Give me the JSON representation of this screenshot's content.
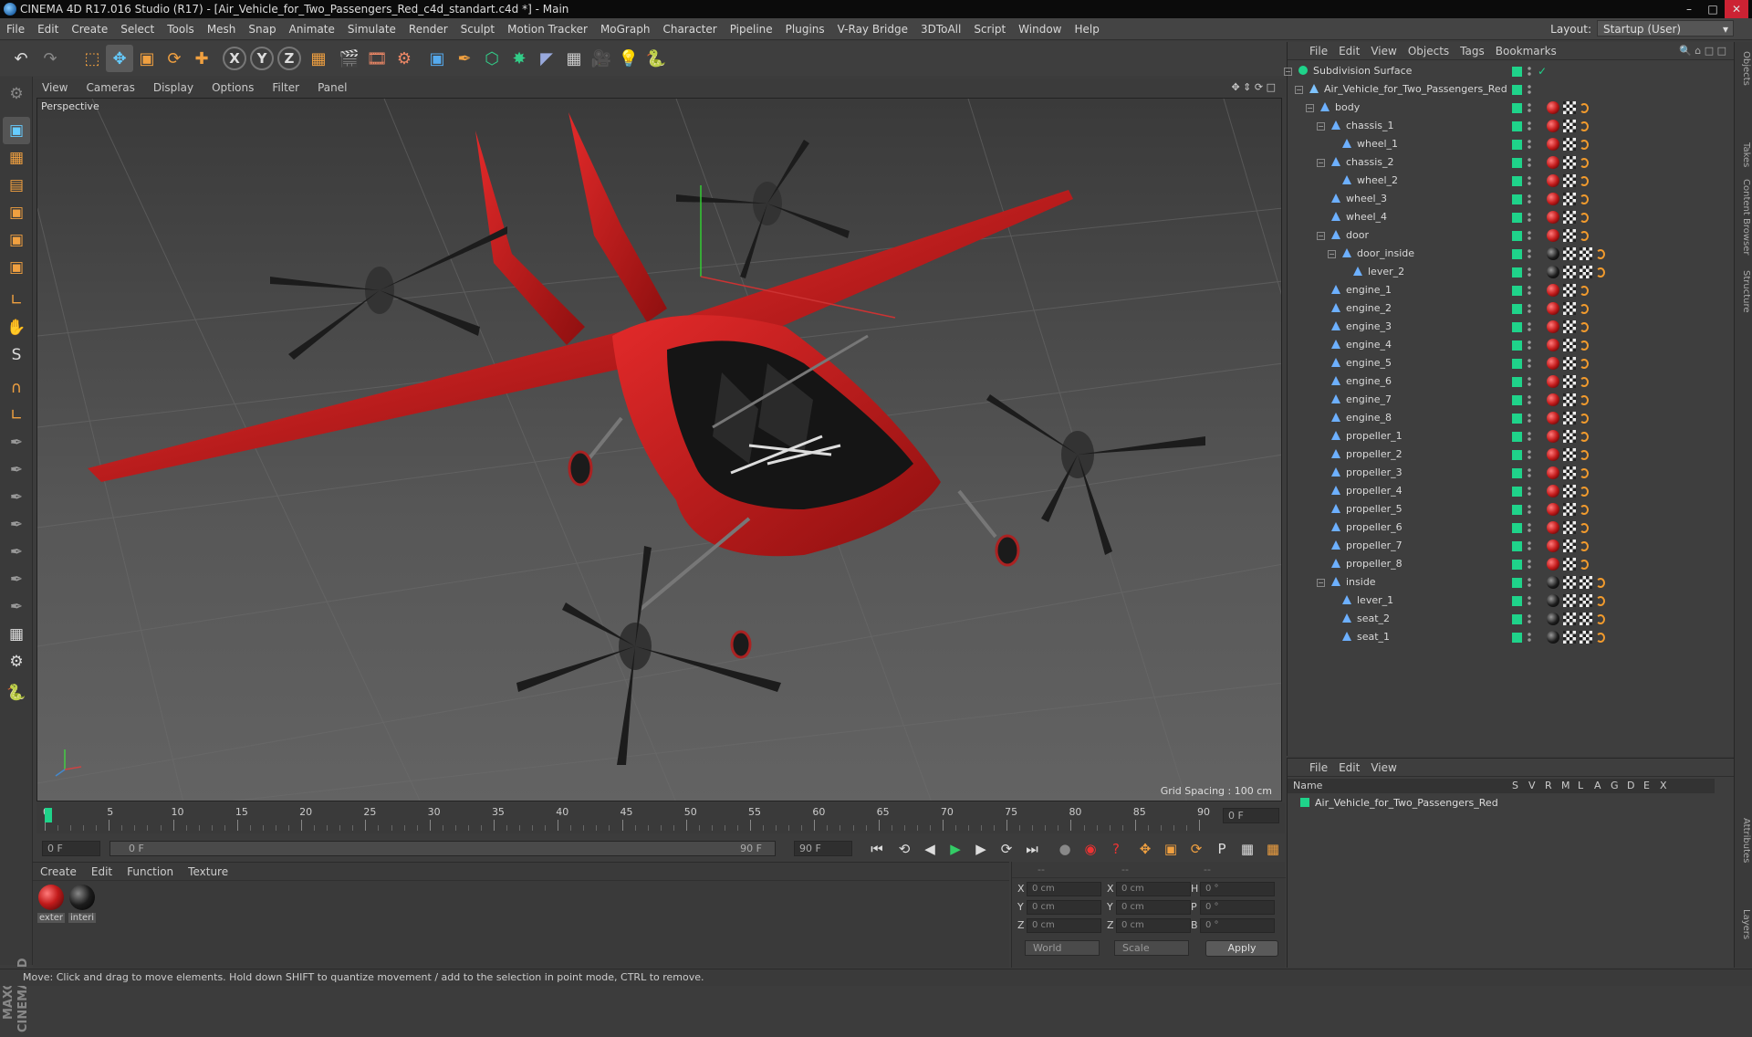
{
  "window": {
    "title": "CINEMA 4D R17.016 Studio (R17) - [Air_Vehicle_for_Two_Passengers_Red_c4d_standart.c4d *] - Main"
  },
  "menubar": [
    "File",
    "Edit",
    "Create",
    "Select",
    "Tools",
    "Mesh",
    "Snap",
    "Animate",
    "Simulate",
    "Render",
    "Sculpt",
    "Motion Tracker",
    "MoGraph",
    "Character",
    "Pipeline",
    "Plugins",
    "V-Ray Bridge",
    "3DToAll",
    "Script",
    "Window",
    "Help"
  ],
  "layout": {
    "label": "Layout:",
    "value": "Startup (User)"
  },
  "viewport": {
    "menu": [
      "View",
      "Cameras",
      "Display",
      "Options",
      "Filter",
      "Panel"
    ],
    "camera_label": "Perspective",
    "grid_spacing": "Grid Spacing : 100 cm"
  },
  "timeline": {
    "ticks": [
      "0",
      "5",
      "10",
      "15",
      "20",
      "25",
      "30",
      "35",
      "40",
      "45",
      "50",
      "55",
      "60",
      "65",
      "70",
      "75",
      "80",
      "85",
      "90"
    ],
    "end_frame_field": "0 F",
    "current_frame": "0 F",
    "range_start": "0 F",
    "range_end": "90 F",
    "max_frame": "90 F"
  },
  "materials": {
    "menu": [
      "Create",
      "Edit",
      "Function",
      "Texture"
    ],
    "items": [
      {
        "name": "exter",
        "color": "#c21b1b"
      },
      {
        "name": "interi",
        "color": "#1c1c1c"
      }
    ]
  },
  "coordinates": {
    "header": [
      "--",
      "--",
      "--"
    ],
    "rows": [
      {
        "a": "X",
        "av": "0 cm",
        "b": "X",
        "bv": "0 cm",
        "c": "H",
        "cv": "0 °"
      },
      {
        "a": "Y",
        "av": "0 cm",
        "b": "Y",
        "bv": "0 cm",
        "c": "P",
        "cv": "0 °"
      },
      {
        "a": "Z",
        "av": "0 cm",
        "b": "Z",
        "bv": "0 cm",
        "c": "B",
        "cv": "0 °"
      }
    ],
    "space": "World",
    "mode": "Scale",
    "apply": "Apply"
  },
  "status": "Move: Click and drag to move elements. Hold down SHIFT to quantize movement / add to the selection in point mode, CTRL to remove.",
  "object_manager": {
    "menu": [
      "File",
      "Edit",
      "View",
      "Objects",
      "Tags",
      "Bookmarks"
    ],
    "objects": [
      {
        "name": "Subdivision Surface",
        "depth": 0,
        "tag": "none"
      },
      {
        "name": "Air_Vehicle_for_Two_Passengers_Red",
        "depth": 1,
        "tag": "none"
      },
      {
        "name": "body",
        "depth": 2,
        "tag": "red"
      },
      {
        "name": "chassis_1",
        "depth": 3,
        "tag": "red"
      },
      {
        "name": "wheel_1",
        "depth": 4,
        "tag": "red"
      },
      {
        "name": "chassis_2",
        "depth": 3,
        "tag": "red"
      },
      {
        "name": "wheel_2",
        "depth": 4,
        "tag": "red"
      },
      {
        "name": "wheel_3",
        "depth": 3,
        "tag": "red"
      },
      {
        "name": "wheel_4",
        "depth": 3,
        "tag": "red"
      },
      {
        "name": "door",
        "depth": 3,
        "tag": "red"
      },
      {
        "name": "door_inside",
        "depth": 4,
        "tag": "black"
      },
      {
        "name": "lever_2",
        "depth": 5,
        "tag": "black"
      },
      {
        "name": "engine_1",
        "depth": 3,
        "tag": "red"
      },
      {
        "name": "engine_2",
        "depth": 3,
        "tag": "red"
      },
      {
        "name": "engine_3",
        "depth": 3,
        "tag": "red"
      },
      {
        "name": "engine_4",
        "depth": 3,
        "tag": "red"
      },
      {
        "name": "engine_5",
        "depth": 3,
        "tag": "red"
      },
      {
        "name": "engine_6",
        "depth": 3,
        "tag": "red"
      },
      {
        "name": "engine_7",
        "depth": 3,
        "tag": "red"
      },
      {
        "name": "engine_8",
        "depth": 3,
        "tag": "red"
      },
      {
        "name": "propeller_1",
        "depth": 3,
        "tag": "red"
      },
      {
        "name": "propeller_2",
        "depth": 3,
        "tag": "red"
      },
      {
        "name": "propeller_3",
        "depth": 3,
        "tag": "red"
      },
      {
        "name": "propeller_4",
        "depth": 3,
        "tag": "red"
      },
      {
        "name": "propeller_5",
        "depth": 3,
        "tag": "red"
      },
      {
        "name": "propeller_6",
        "depth": 3,
        "tag": "red"
      },
      {
        "name": "propeller_7",
        "depth": 3,
        "tag": "red"
      },
      {
        "name": "propeller_8",
        "depth": 3,
        "tag": "red"
      },
      {
        "name": "inside",
        "depth": 3,
        "tag": "black"
      },
      {
        "name": "lever_1",
        "depth": 4,
        "tag": "black"
      },
      {
        "name": "seat_2",
        "depth": 4,
        "tag": "black"
      },
      {
        "name": "seat_1",
        "depth": 4,
        "tag": "black"
      }
    ]
  },
  "layer_manager": {
    "menu": [
      "File",
      "Edit",
      "View"
    ],
    "columns": [
      "Name",
      "S",
      "V",
      "R",
      "M",
      "L",
      "A",
      "G",
      "D",
      "E",
      "X"
    ],
    "layer": "Air_Vehicle_for_Two_Passengers_Red"
  },
  "right_tabs": [
    "Objects",
    "Takes",
    "Content Browser",
    "Structure",
    "Attributes",
    "Layers"
  ],
  "colors": {
    "accent_green": "#1fd38a",
    "vehicle_red": "#c21b1b",
    "tag_orange": "#f29b2d"
  }
}
